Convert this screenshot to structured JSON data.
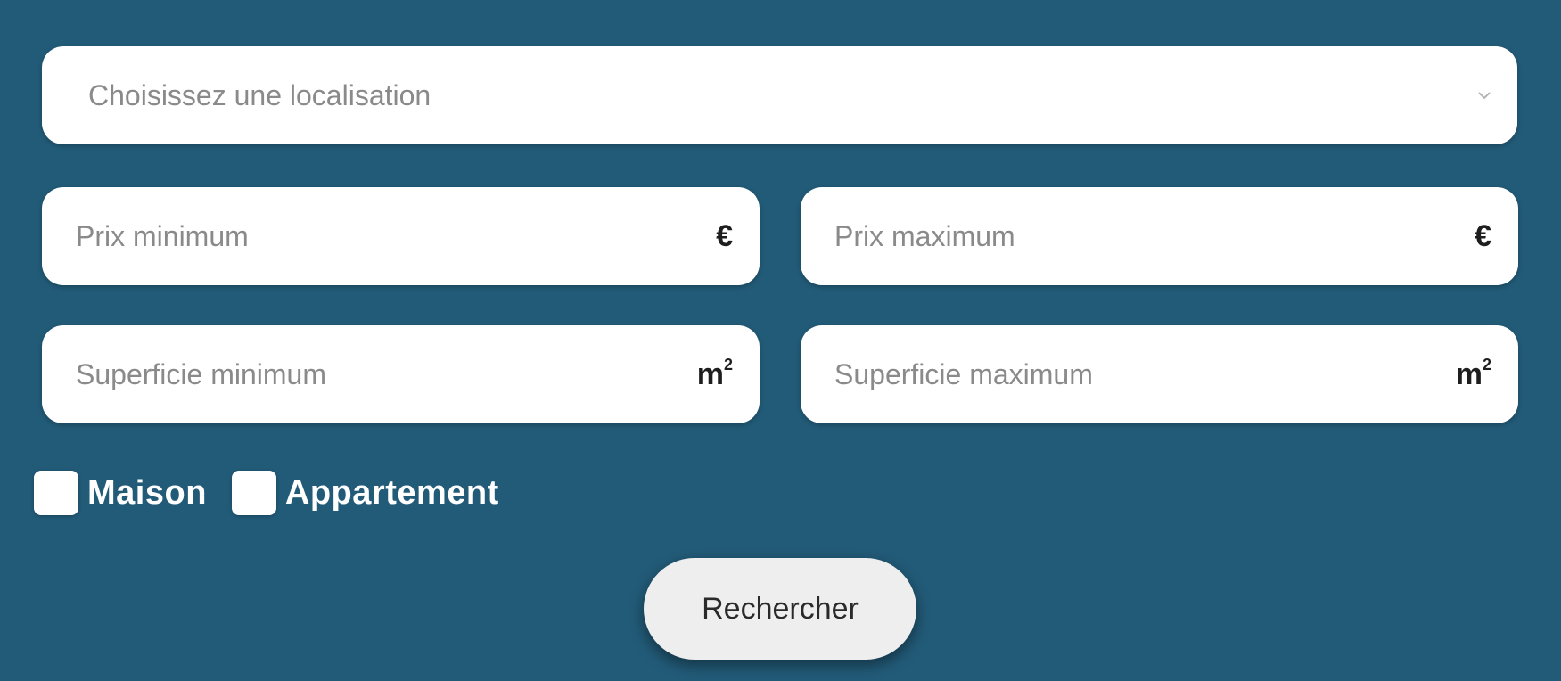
{
  "form": {
    "location": {
      "placeholder": "Choisissez une localisation",
      "icon": "chevron-up-down-icon"
    },
    "price_min": {
      "placeholder": "Prix minimum",
      "unit": "€"
    },
    "price_max": {
      "placeholder": "Prix maximum",
      "unit": "€"
    },
    "surface_min": {
      "placeholder": "Superficie minimum",
      "unit": "m",
      "unit_sup": "2"
    },
    "surface_max": {
      "placeholder": "Superficie maximum",
      "unit": "m",
      "unit_sup": "2"
    },
    "property_types": [
      {
        "label": "Maison",
        "checked": false
      },
      {
        "label": "Appartement",
        "checked": false
      }
    ],
    "submit_label": "Rechercher"
  },
  "colors": {
    "background": "#225b78",
    "field": "#ffffff",
    "button": "#eeeeee"
  }
}
